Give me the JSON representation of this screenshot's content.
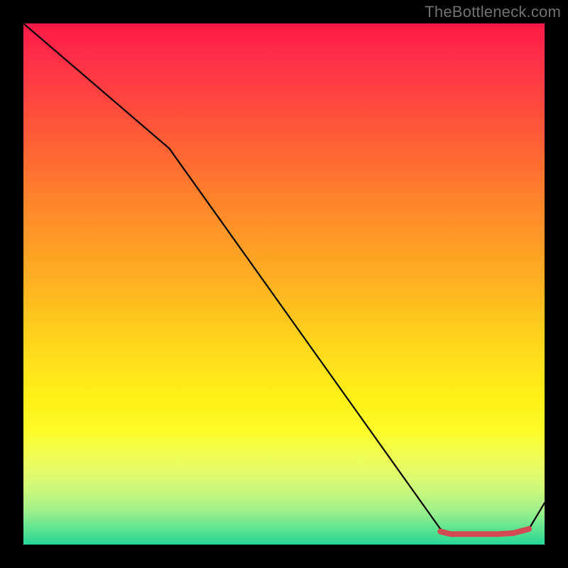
{
  "watermark": "TheBottleneck.com",
  "chart_data": {
    "type": "line",
    "title": "",
    "xlabel": "",
    "ylabel": "",
    "xlim": [
      0,
      100
    ],
    "ylim": [
      0,
      100
    ],
    "grid": false,
    "note": "No numeric axes shown; values are percent of plot area (0 bottom-left, 100 top-right).",
    "series": [
      {
        "name": "black-curve",
        "color": "#000000",
        "x": [
          0,
          28,
          80,
          82,
          85,
          88,
          91,
          94,
          97,
          100
        ],
        "y": [
          100,
          76,
          3,
          2,
          2,
          2,
          2,
          2,
          3,
          8
        ]
      },
      {
        "name": "red-flat",
        "color": "#d24a52",
        "x": [
          80,
          82,
          85,
          88,
          91,
          94,
          97
        ],
        "y": [
          2.5,
          2,
          2,
          2,
          2,
          2.2,
          3
        ]
      }
    ]
  },
  "colors": {
    "background": "#000000",
    "watermark": "#707070",
    "gradient_top": "#ff1846",
    "gradient_bottom": "#27d795",
    "black_line": "#000000",
    "red_line": "#d24a52"
  }
}
